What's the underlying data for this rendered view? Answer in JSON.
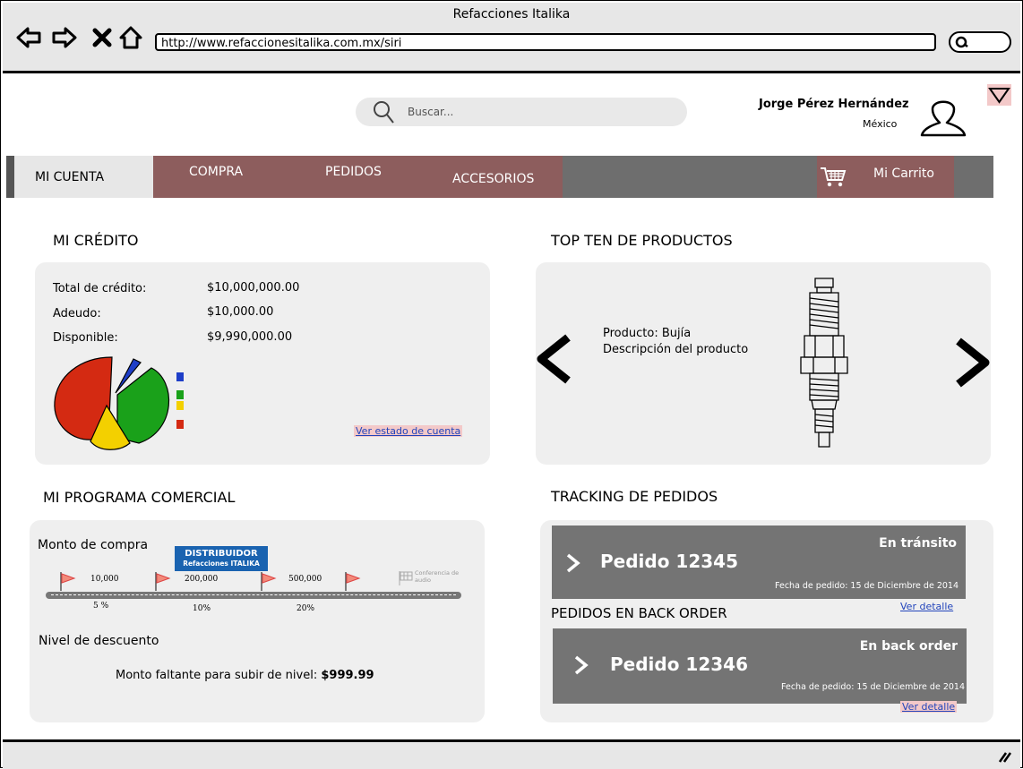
{
  "window": {
    "title": "Refacciones Italika"
  },
  "browser": {
    "url": "http://www.refaccionesitalika.com.mx/siri"
  },
  "search": {
    "placeholder": "Buscar..."
  },
  "user": {
    "name": "Jorge Pérez Hernández",
    "country": "México"
  },
  "nav": {
    "tabs": [
      {
        "label": "MI CUENTA",
        "active": true
      },
      {
        "label": "COMPRA"
      },
      {
        "label": "PEDIDOS"
      },
      {
        "label": "ACCESORIOS"
      }
    ],
    "cart_label": "Mi Carrito"
  },
  "credit": {
    "title": "MI CRÉDITO",
    "rows": [
      {
        "label": "Total de crédito:",
        "value": "$10,000,000.00"
      },
      {
        "label": "Adeudo:",
        "value": "$10,000.00"
      },
      {
        "label": "Disponible:",
        "value": "$9,990,000.00"
      }
    ],
    "link": "Ver estado de cuenta",
    "pie_colors": [
      "#d42a12",
      "#1e3ec8",
      "#1aa11a",
      "#f3d000"
    ],
    "legend_colors": [
      "#1e3ec8",
      "#1aa11a",
      "#f3d000",
      "#d42a12"
    ]
  },
  "top_ten": {
    "title": "TOP TEN DE PRODUCTOS",
    "product": "Producto: Bujía",
    "description": "Descripción del producto"
  },
  "program": {
    "title": "MI PROGRAMA COMERCIAL",
    "purchase_label": "Monto de compra",
    "badge_line1": "DISTRIBUIDOR",
    "badge_line2": "Refacciones ITALIKA",
    "amounts": [
      "10,000",
      "200,000",
      "500,000"
    ],
    "percents": [
      "5 %",
      "10%",
      "20%"
    ],
    "finish_label": "Conferencia de audio",
    "discount_label": "Nivel de descuento",
    "missing_label": "Monto faltante para subir de nivel:",
    "missing_value": "$999.99"
  },
  "tracking": {
    "title": "TRACKING DE PEDIDOS",
    "status": "En tránsito",
    "order": "Pedido 12345",
    "date": "Fecha de pedido: 15 de Diciembre de 2014",
    "link": "Ver detalle"
  },
  "backorder": {
    "title": "PEDIDOS EN BACK ORDER",
    "status": "En back order",
    "order": "Pedido 12346",
    "date": "Fecha de pedido: 15 de Diciembre de 2014",
    "link": "Ver detalle"
  }
}
